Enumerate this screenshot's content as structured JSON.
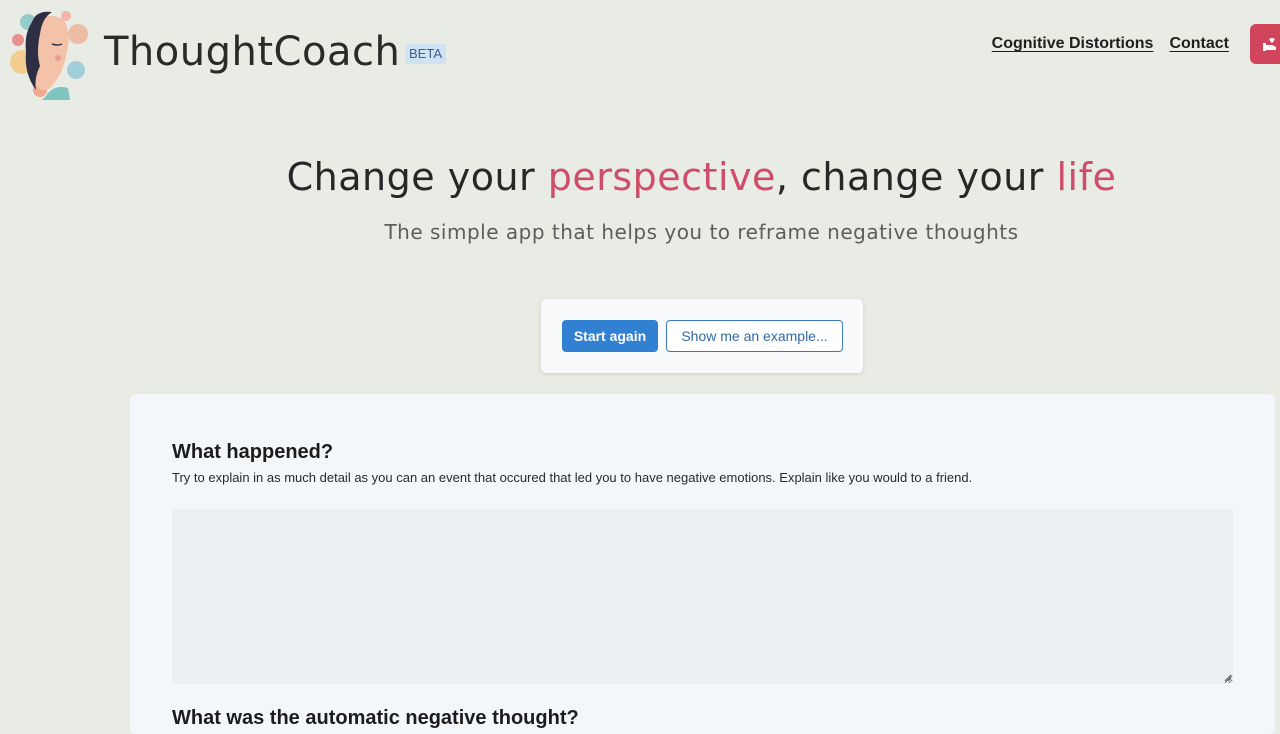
{
  "header": {
    "brand": "ThoughtCoach",
    "badge": "BETA",
    "nav": [
      "Cognitive Distortions",
      "Contact"
    ],
    "donate_icon": "hand-heart-icon"
  },
  "hero": {
    "title_part1": "Change your ",
    "title_accent1": "perspective",
    "title_part2": ", change your ",
    "title_accent2": "life",
    "subtitle": "The simple app that helps you to reframe negative thoughts"
  },
  "actions": {
    "start_again": "Start again",
    "show_example": "Show me an example..."
  },
  "form": {
    "q1_title": "What happened?",
    "q1_help": "Try to explain in as much detail as you can an event that occured that led you to have negative emotions. Explain like you would to a friend.",
    "q1_value": "",
    "q2_title": "What was the automatic negative thought?"
  },
  "colors": {
    "background": "#e8ece4",
    "accent": "#cf4d68",
    "primary": "#3180d1",
    "donate": "#d0445c"
  }
}
